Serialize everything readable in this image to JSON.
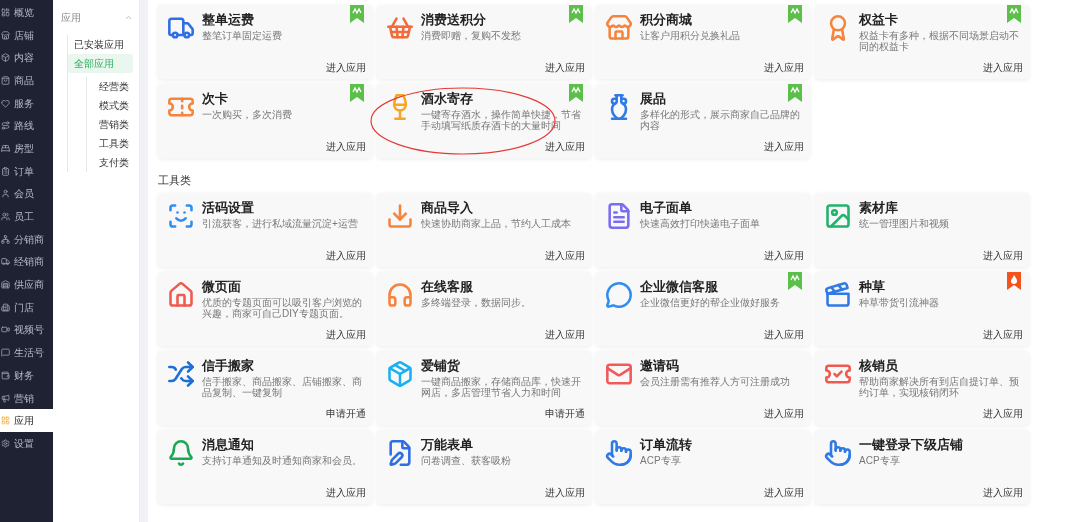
{
  "nav": [
    {
      "label": "概览",
      "selected": false
    },
    {
      "label": "店铺",
      "selected": false
    },
    {
      "label": "内容",
      "selected": false
    },
    {
      "label": "商品",
      "selected": false
    },
    {
      "label": "服务",
      "selected": false
    },
    {
      "label": "路线",
      "selected": false
    },
    {
      "label": "房型",
      "selected": false
    },
    {
      "label": "订单",
      "selected": false
    },
    {
      "label": "会员",
      "selected": false
    },
    {
      "label": "员工",
      "selected": false
    },
    {
      "label": "分销商",
      "selected": false
    },
    {
      "label": "经销商",
      "selected": false
    },
    {
      "label": "供应商",
      "selected": false
    },
    {
      "label": "门店",
      "selected": false
    },
    {
      "label": "视频号",
      "selected": false
    },
    {
      "label": "生活号",
      "selected": false
    },
    {
      "label": "财务",
      "selected": false
    },
    {
      "label": "营销",
      "selected": false
    },
    {
      "label": "应用",
      "selected": true
    },
    {
      "label": "设置",
      "selected": false
    }
  ],
  "sub_sidebar": {
    "title": "应用",
    "expanded": true,
    "items": [
      {
        "label": "已安装应用",
        "selected": false
      },
      {
        "label": "全部应用",
        "selected": true,
        "children": [
          {
            "label": "经营类",
            "selected": false
          },
          {
            "label": "模式类",
            "selected": false
          },
          {
            "label": "营销类",
            "selected": false
          },
          {
            "label": "工具类",
            "selected": false
          },
          {
            "label": "支付类",
            "selected": false
          }
        ]
      }
    ]
  },
  "sections": [
    {
      "cards": [
        {
          "title": "整单运费",
          "description": "整笔订单固定运费",
          "action": "进入应用",
          "new_tag": true,
          "hot_tag": false,
          "circled": false
        },
        {
          "title": "消费送积分",
          "description": "消费即赠，复购不发愁",
          "action": "进入应用",
          "new_tag": true,
          "hot_tag": false,
          "circled": false
        },
        {
          "title": "积分商城",
          "description": "让客户用积分兑换礼品",
          "action": "进入应用",
          "new_tag": true,
          "hot_tag": false,
          "circled": false
        },
        {
          "title": "权益卡",
          "description": "权益卡有多种，根据不同场景启动不同的权益卡",
          "action": "进入应用",
          "new_tag": true,
          "hot_tag": false,
          "circled": false
        },
        {
          "title": "次卡",
          "description": "一次购买，多次消费",
          "action": "进入应用",
          "new_tag": true,
          "hot_tag": false,
          "circled": false
        },
        {
          "title": "酒水寄存",
          "description": "一键寄存酒水，操作简单快捷，节省手动填写纸质存酒卡的大量时间",
          "action": "进入应用",
          "new_tag": true,
          "hot_tag": false,
          "circled": true
        },
        {
          "title": "展品",
          "description": "多样化的形式，展示商家自己品牌的内容",
          "action": "进入应用",
          "new_tag": true,
          "hot_tag": false,
          "circled": false
        }
      ]
    },
    {
      "title": "工具类",
      "cards": [
        {
          "title": "活码设置",
          "description": "引流获客，进行私域流量沉淀+运营",
          "action": "进入应用",
          "new_tag": false,
          "hot_tag": false,
          "circled": false
        },
        {
          "title": "商品导入",
          "description": "快速协助商家上品，节约人工成本",
          "action": "进入应用",
          "new_tag": false,
          "hot_tag": false,
          "circled": false
        },
        {
          "title": "电子面单",
          "description": "快速高效打印快递电子面单",
          "action": "进入应用",
          "new_tag": false,
          "hot_tag": false,
          "circled": false
        },
        {
          "title": "素材库",
          "description": "统一管理图片和视频",
          "action": "进入应用",
          "new_tag": false,
          "hot_tag": false,
          "circled": false
        },
        {
          "title": "微页面",
          "description": "优质的专题页面可以吸引客户浏览的兴趣，商家可自己DIY专题页面。",
          "action": "进入应用",
          "new_tag": false,
          "hot_tag": false,
          "circled": false
        },
        {
          "title": "在线客服",
          "description": "多终端登录，数据同步。",
          "action": "进入应用",
          "new_tag": false,
          "hot_tag": false,
          "circled": false
        },
        {
          "title": "企业微信客服",
          "description": "企业微信更好的帮企业做好服务",
          "action": "进入应用",
          "new_tag": true,
          "hot_tag": false,
          "circled": false
        },
        {
          "title": "种草",
          "description": "种草带货引流神器",
          "action": "进入应用",
          "new_tag": false,
          "hot_tag": true,
          "circled": false
        },
        {
          "title": "信手搬家",
          "description": "信手搬家、商品搬家、店铺搬家、商品复制、一键复制",
          "action": "申请开通",
          "new_tag": false,
          "hot_tag": false,
          "circled": false
        },
        {
          "title": "爱铺货",
          "description": "一键商品搬家，存储商品库，快速开网店，多店管理节省人力和时间",
          "action": "申请开通",
          "new_tag": false,
          "hot_tag": false,
          "circled": false
        },
        {
          "title": "邀请码",
          "description": "会员注册需有推荐人方可注册成功",
          "action": "进入应用",
          "new_tag": false,
          "hot_tag": false,
          "circled": false
        },
        {
          "title": "核销员",
          "description": "帮助商家解决所有到店自提订单、预约订单，实现核销闭环",
          "action": "进入应用",
          "new_tag": false,
          "hot_tag": false,
          "circled": false
        },
        {
          "title": "消息通知",
          "description": "支持订单通知及时通知商家和会员。",
          "action": "进入应用",
          "new_tag": false,
          "hot_tag": false,
          "circled": false
        },
        {
          "title": "万能表单",
          "description": "问卷调查、获客吸粉",
          "action": "进入应用",
          "new_tag": false,
          "hot_tag": false,
          "circled": false
        },
        {
          "title": "订单流转",
          "description": "ACP专享",
          "action": "进入应用",
          "new_tag": false,
          "hot_tag": false,
          "circled": false
        },
        {
          "title": "一键登录下级店铺",
          "description": "ACP专享",
          "action": "进入应用",
          "new_tag": false,
          "hot_tag": false,
          "circled": false
        }
      ]
    }
  ]
}
